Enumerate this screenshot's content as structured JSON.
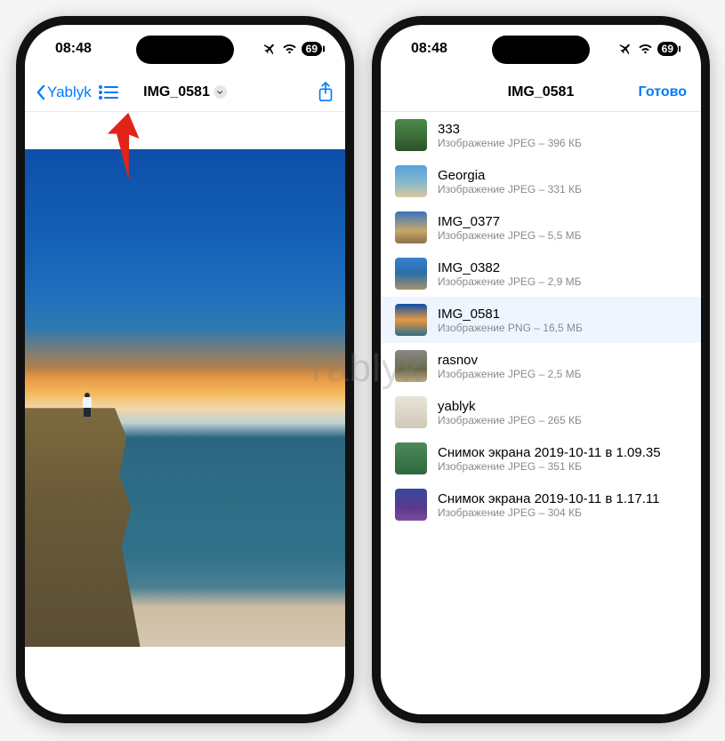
{
  "status": {
    "time": "08:48",
    "battery": "69"
  },
  "left": {
    "back_label": "Yablyk",
    "title": "IMG_0581"
  },
  "right": {
    "title": "IMG_0581",
    "done_label": "Готово",
    "sub_prefix": "Изображение",
    "sub_sep": " – ",
    "files": [
      {
        "name": "333",
        "fmt": "JPEG",
        "size": "396 КБ"
      },
      {
        "name": "Georgia",
        "fmt": "JPEG",
        "size": "331 КБ"
      },
      {
        "name": "IMG_0377",
        "fmt": "JPEG",
        "size": "5,5 МБ"
      },
      {
        "name": "IMG_0382",
        "fmt": "JPEG",
        "size": "2,9 МБ"
      },
      {
        "name": "IMG_0581",
        "fmt": "PNG",
        "size": "16,5 МБ"
      },
      {
        "name": "rasnov",
        "fmt": "JPEG",
        "size": "2,5 МБ"
      },
      {
        "name": "yablyk",
        "fmt": "JPEG",
        "size": "265 КБ"
      },
      {
        "name": "Снимок экрана 2019-10-11 в 1.09.35",
        "fmt": "JPEG",
        "size": "351 КБ"
      },
      {
        "name": "Снимок экрана 2019-10-11 в 1.17.11",
        "fmt": "JPEG",
        "size": "304 КБ"
      }
    ]
  },
  "watermark": "Yablyk"
}
